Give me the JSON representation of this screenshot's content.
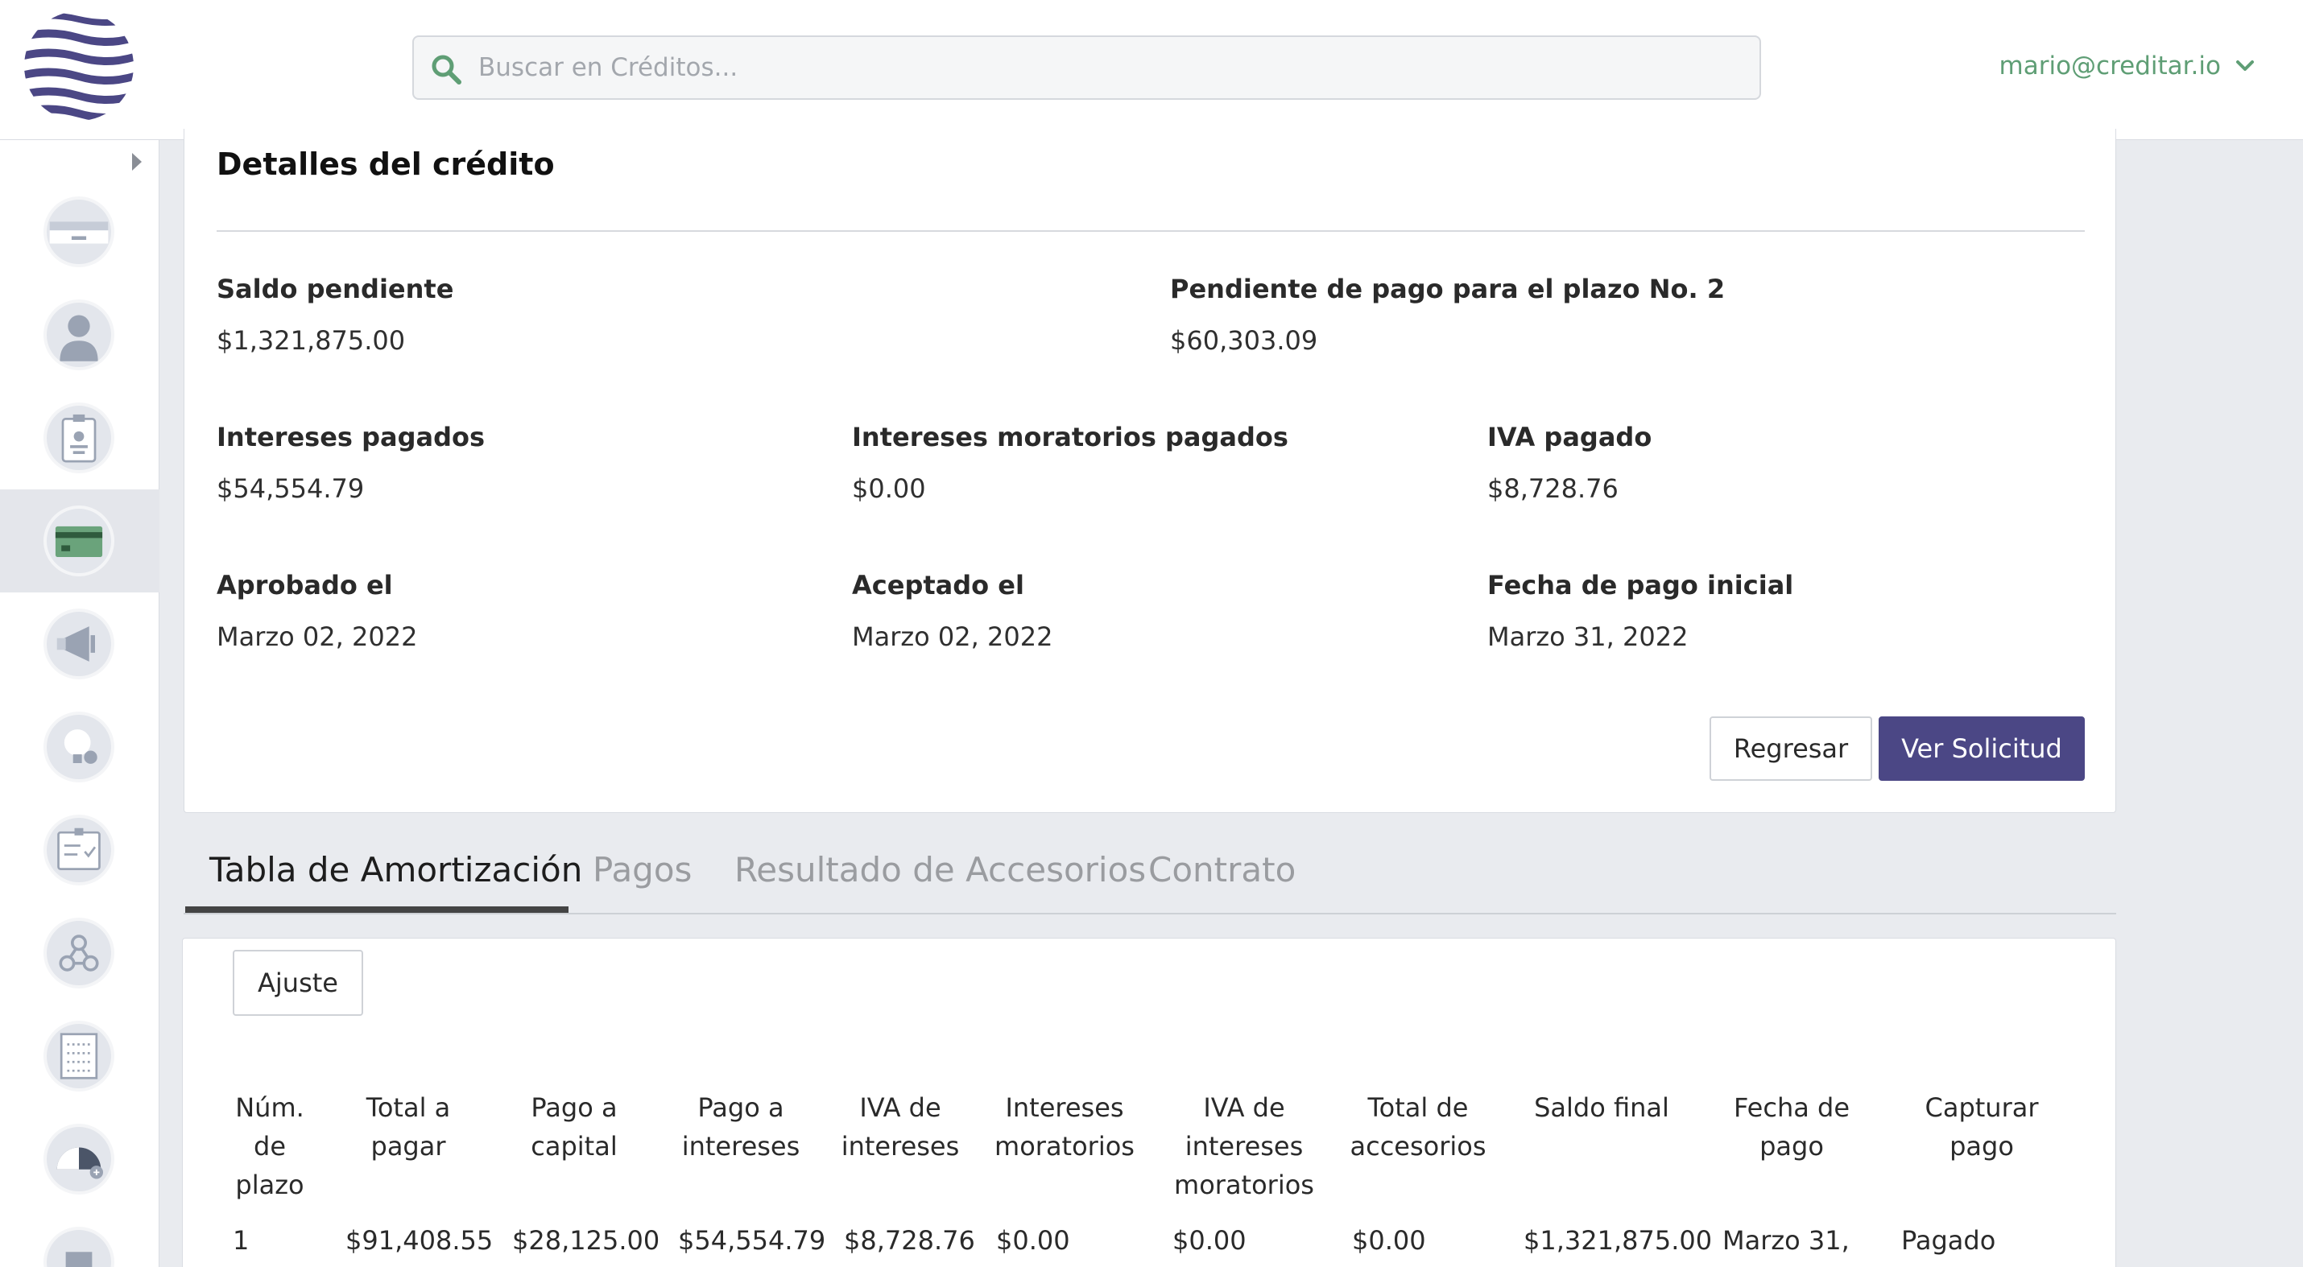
{
  "header": {
    "search_placeholder": "Buscar en Créditos...",
    "user_email": "mario@creditar.io"
  },
  "sidebar": {
    "items": [
      {
        "icon": "card-reader-icon"
      },
      {
        "icon": "user-icon"
      },
      {
        "icon": "id-badge-icon"
      },
      {
        "icon": "credit-card-icon",
        "active": true
      },
      {
        "icon": "megaphone-icon"
      },
      {
        "icon": "lightbulb-money-icon"
      },
      {
        "icon": "checklist-clipboard-icon"
      },
      {
        "icon": "webhook-icon"
      },
      {
        "icon": "list-document-icon"
      },
      {
        "icon": "gauge-add-icon"
      },
      {
        "icon": "box-icon"
      }
    ]
  },
  "details": {
    "title": "Detalles del crédito",
    "saldo_label": "Saldo pendiente",
    "saldo_value": "$1,321,875.00",
    "pendiente_label": "Pendiente de pago para el plazo No. 2",
    "pendiente_value": "$60,303.09",
    "intereses_label": "Intereses pagados",
    "intereses_value": "$54,554.79",
    "moratorios_label": "Intereses moratorios pagados",
    "moratorios_value": "$0.00",
    "iva_label": "IVA pagado",
    "iva_value": "$8,728.76",
    "aprobado_label": "Aprobado el",
    "aprobado_value": "Marzo 02, 2022",
    "aceptado_label": "Aceptado el",
    "aceptado_value": "Marzo 02, 2022",
    "fecha_label": "Fecha de pago inicial",
    "fecha_value": "Marzo 31, 2022",
    "back_button": "Regresar",
    "view_button": "Ver Solicitud"
  },
  "tabs": [
    "Tabla de Amortización",
    "Pagos",
    "Resultado de Accesorios",
    "Contrato"
  ],
  "amortization": {
    "adjust_button": "Ajuste",
    "headers": [
      [
        "Núm.",
        "de",
        "plazo"
      ],
      [
        "Total a",
        "pagar"
      ],
      [
        "Pago a",
        "capital"
      ],
      [
        "Pago a",
        "intereses"
      ],
      [
        "IVA de",
        "intereses"
      ],
      [
        "Intereses",
        "moratorios"
      ],
      [
        "IVA de",
        "intereses",
        "moratorios"
      ],
      [
        "Total de",
        "accesorios"
      ],
      [
        "Saldo final"
      ],
      [
        "Fecha de",
        "pago"
      ],
      [
        "Capturar",
        "pago"
      ]
    ],
    "rows": [
      [
        "1",
        "$91,408.55",
        "$28,125.00",
        "$54,554.79",
        "$8,728.76",
        "$0.00",
        "$0.00",
        "$0.00",
        "$1,321,875.00",
        "Marzo 31,",
        "Pagado"
      ]
    ]
  }
}
